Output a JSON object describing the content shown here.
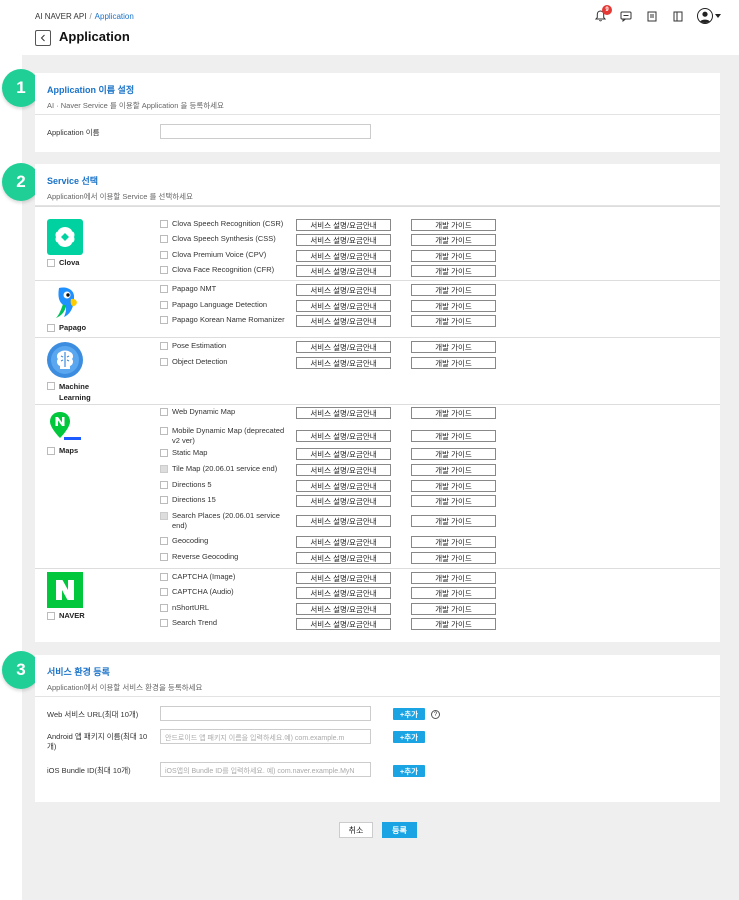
{
  "breadcrumb": {
    "root": "AI NAVER API",
    "separator": "/",
    "current": "Application"
  },
  "page_title": "Application",
  "topbar": {
    "notification_count": "9"
  },
  "steps": [
    "1",
    "2",
    "3"
  ],
  "section1": {
    "title": "Application 이름 설정",
    "desc": "AI · Naver Service 를 이용할 Application 을 등록하세요",
    "name_label": "Application 이름",
    "name_value": ""
  },
  "section2": {
    "title": "Service 선택",
    "desc": "Application에서 이용할 Service 를 선택하세요",
    "desc_button": "서비스 설명/요금안내",
    "guide_button": "개발 가이드",
    "groups": [
      {
        "name": "Clova",
        "items": [
          "Clova Speech Recognition (CSR)",
          "Clova Speech Synthesis (CSS)",
          "Clova Premium Voice (CPV)",
          "Clova Face Recognition (CFR)"
        ]
      },
      {
        "name": "Papago",
        "items": [
          "Papago NMT",
          "Papago Language Detection",
          "Papago Korean Name Romanizer"
        ]
      },
      {
        "name": "Machine Learning",
        "items": [
          "Pose Estimation",
          "Object Detection"
        ]
      },
      {
        "name": "Maps",
        "items": [
          "Web Dynamic Map",
          "Mobile Dynamic Map (deprecated v2 ver)",
          "Static Map",
          "Tile Map (20.06.01 service end)",
          "Directions 5",
          "Directions 15",
          "Search Places (20.06.01 service end)",
          "Geocoding",
          "Reverse Geocoding"
        ]
      },
      {
        "name": "NAVER",
        "items": [
          "CAPTCHA (Image)",
          "CAPTCHA (Audio)",
          "nShortURL",
          "Search Trend"
        ]
      }
    ]
  },
  "section3": {
    "title": "서비스 환경 등록",
    "desc": "Application에서 이용할 서비스 환경을 등록하세요",
    "web_label": "Web 서비스 URL(최대 10개)",
    "web_placeholder": "",
    "android_label": "Android 앱 패키지 이름(최대 10개)",
    "android_placeholder": "안드로이드 앱 패키지 이름을 입력하세요.예) com.example.m",
    "ios_label": "iOS Bundle ID(최대 10개)",
    "ios_placeholder": "iOS앱의 Bundle ID를 입력하세요. 예) com.naver.example.MyN",
    "add_label": "+추가",
    "help": "?"
  },
  "buttons": {
    "cancel": "취소",
    "submit": "등록"
  },
  "colors": {
    "accent": "#1a73c8",
    "button_blue": "#1ba4e4",
    "step_green": "#1fcf96"
  }
}
